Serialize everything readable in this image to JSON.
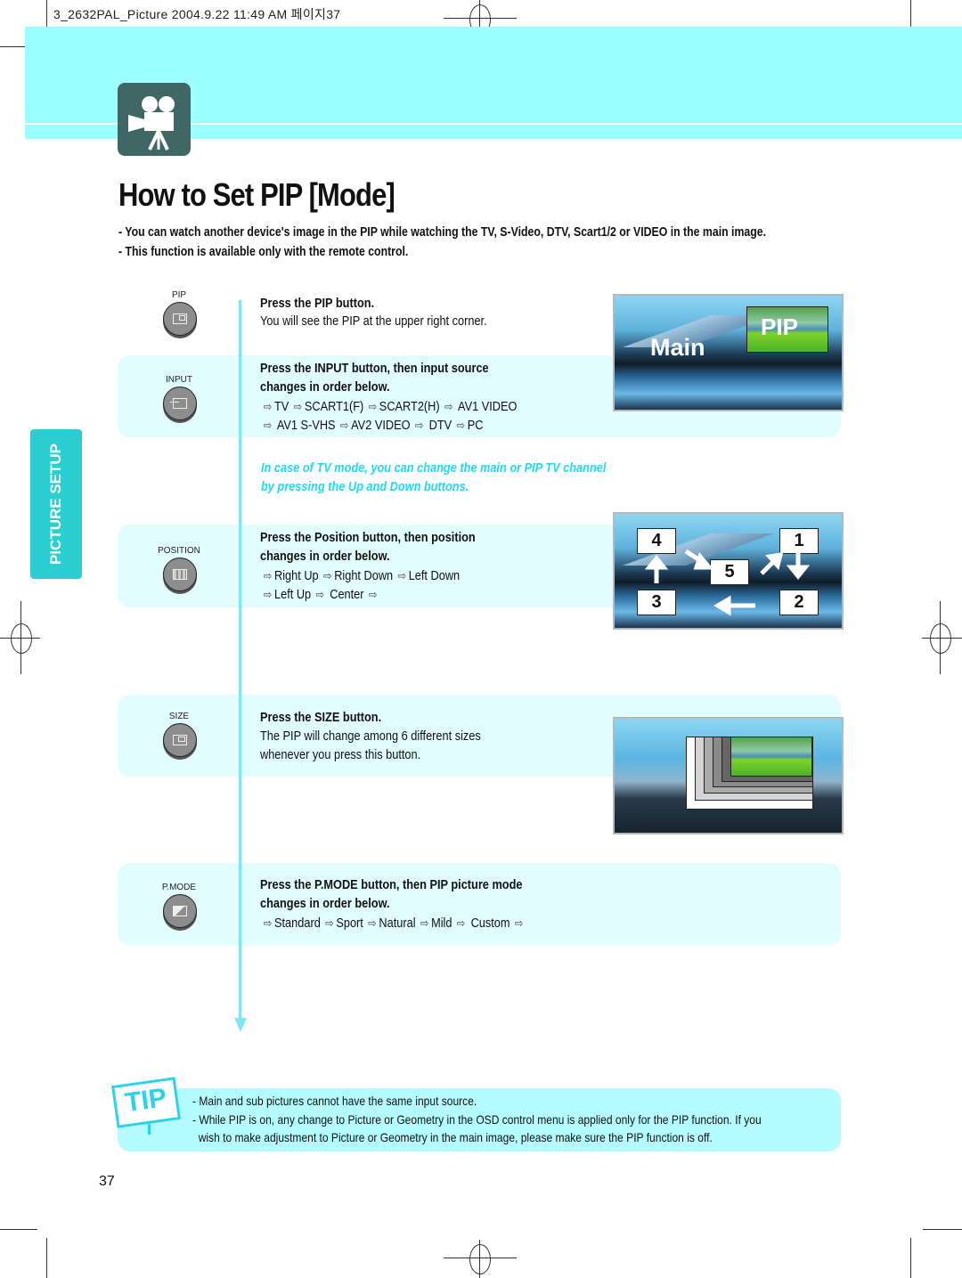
{
  "header_meta": "3_2632PAL_Picture  2004.9.22 11:49 AM 페이지37",
  "page": {
    "title": "How to Set PIP [Mode]",
    "intro": [
      "- You can watch another device's image in the PIP while watching the TV, S-Video, DTV, Scart1/2 or VIDEO in the main image.",
      "- This function is available only with the remote control."
    ],
    "sidebar_tab": "PICTURE SETUP",
    "page_number": "37"
  },
  "icons": {
    "logo": "movie-camera-icon",
    "sequence_arrow": "hollow-right-arrow-icon",
    "sequence_arrow_glyph": "⇨"
  },
  "steps": {
    "pip": {
      "button_label": "PIP",
      "title": "Press the PIP button.",
      "text": "You will see the PIP at the upper right corner."
    },
    "input": {
      "button_label": "INPUT",
      "title_line1": "Press the INPUT button, then input source",
      "title_line2": "changes in order below.",
      "sequence_line1": [
        "TV",
        "SCART1(F)",
        "SCART2(H)",
        "AV1 VIDEO"
      ],
      "sequence_line2": [
        "AV1 S-VHS",
        "AV2 VIDEO",
        "DTV",
        "PC"
      ]
    },
    "tv_note": {
      "line1": "In case of TV mode, you can change the main or PIP TV channel",
      "line2": "by pressing the Up and Down buttons."
    },
    "position": {
      "button_label": "POSITION",
      "title_line1": "Press the Position button, then position",
      "title_line2": "changes in order below.",
      "sequence_line1": [
        "Right Up",
        "Right Down",
        "Left Down"
      ],
      "sequence_line2": [
        "Left Up",
        "Center"
      ]
    },
    "size": {
      "button_label": "SIZE",
      "title": "Press the SIZE button.",
      "text_line1": "The PIP will change among 6 different sizes",
      "text_line2": "whenever you press this button."
    },
    "pmode": {
      "button_label": "P.MODE",
      "title_line1": "Press the P.MODE button, then PIP picture mode",
      "title_line2": "changes in order below.",
      "sequence": [
        "Standard",
        "Sport",
        "Natural",
        "Mild",
        "Custom"
      ]
    }
  },
  "illustrations": {
    "pip_scene": {
      "main_label": "Main",
      "pip_label": "PIP"
    },
    "position_scene": {
      "boxes": [
        "4",
        "1",
        "5",
        "3",
        "2"
      ]
    },
    "size_scene": {
      "size_count": "6"
    }
  },
  "tip": {
    "badge": "TIP",
    "lines": [
      "- Main and sub pictures cannot have the same input source.",
      "- While PIP is on, any change to Picture or Geometry in the OSD control menu is applied only for the PIP function. If you",
      "  wish to make adjustment to Picture or Geometry in the main image, please make sure the PIP function is off."
    ]
  },
  "colors": {
    "band_cyan": "#9bffff",
    "section_bg": "#e2fdff",
    "accent_cyan": "#25d8ef",
    "sidebar_teal": "#2bcfd2",
    "logo_bg": "#3e6766"
  }
}
